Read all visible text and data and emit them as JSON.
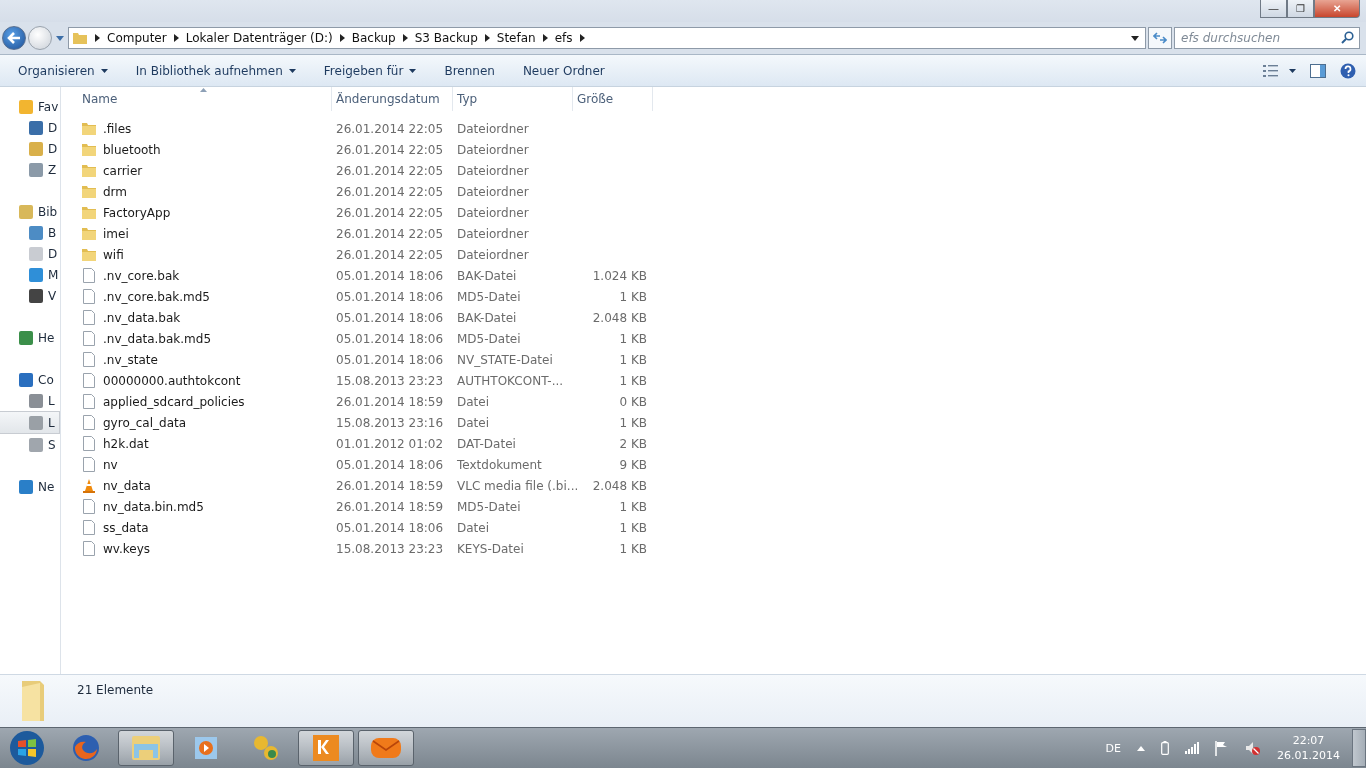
{
  "window": {
    "minimize": "—",
    "maximize": "❐",
    "close": "✕"
  },
  "address": {
    "crumbs": [
      "Computer",
      "Lokaler Datenträger (D:)",
      "Backup",
      "S3 Backup",
      "Stefan",
      "efs"
    ]
  },
  "search": {
    "placeholder": "efs durchsuchen"
  },
  "toolbar": [
    {
      "label": "Organisieren",
      "dropdown": true
    },
    {
      "label": "In Bibliothek aufnehmen",
      "dropdown": true
    },
    {
      "label": "Freigeben für",
      "dropdown": true
    },
    {
      "label": "Brennen",
      "dropdown": false
    },
    {
      "label": "Neuer Ordner",
      "dropdown": false
    }
  ],
  "sidebar": {
    "groups": [
      {
        "label": "Fav",
        "kind": "star",
        "selected": false,
        "children": [
          {
            "label": "D",
            "kind": "desktop",
            "selected": false
          },
          {
            "label": "D",
            "kind": "download",
            "selected": false
          },
          {
            "label": "Z",
            "kind": "recent",
            "selected": false
          }
        ]
      },
      {
        "label": "Bib",
        "kind": "library",
        "selected": false,
        "children": [
          {
            "label": "B",
            "kind": "pictures",
            "selected": false
          },
          {
            "label": "D",
            "kind": "document",
            "selected": false
          },
          {
            "label": "M",
            "kind": "music",
            "selected": false
          },
          {
            "label": "V",
            "kind": "video",
            "selected": false
          }
        ]
      },
      {
        "label": "He",
        "kind": "homegroup",
        "selected": false
      },
      {
        "label": "Co",
        "kind": "computer",
        "selected": false,
        "children": [
          {
            "label": "L",
            "kind": "sysdrive",
            "selected": false
          },
          {
            "label": "L",
            "kind": "drive",
            "selected": true
          },
          {
            "label": "S",
            "kind": "phone",
            "selected": false
          }
        ]
      },
      {
        "label": "Ne",
        "kind": "network",
        "selected": false
      }
    ]
  },
  "table": {
    "columns": [
      "Name",
      "Änderungsdatum",
      "Typ",
      "Größe"
    ],
    "rows": [
      {
        "kind": "folder",
        "name": ".files",
        "date": "26.01.2014 22:05",
        "type": "Dateiordner",
        "size": ""
      },
      {
        "kind": "folder",
        "name": "bluetooth",
        "date": "26.01.2014 22:05",
        "type": "Dateiordner",
        "size": ""
      },
      {
        "kind": "folder",
        "name": "carrier",
        "date": "26.01.2014 22:05",
        "type": "Dateiordner",
        "size": ""
      },
      {
        "kind": "folder",
        "name": "drm",
        "date": "26.01.2014 22:05",
        "type": "Dateiordner",
        "size": ""
      },
      {
        "kind": "folder",
        "name": "FactoryApp",
        "date": "26.01.2014 22:05",
        "type": "Dateiordner",
        "size": ""
      },
      {
        "kind": "folder",
        "name": "imei",
        "date": "26.01.2014 22:05",
        "type": "Dateiordner",
        "size": ""
      },
      {
        "kind": "folder",
        "name": "wifi",
        "date": "26.01.2014 22:05",
        "type": "Dateiordner",
        "size": ""
      },
      {
        "kind": "file",
        "name": ".nv_core.bak",
        "date": "05.01.2014 18:06",
        "type": "BAK-Datei",
        "size": "1.024 KB"
      },
      {
        "kind": "file",
        "name": ".nv_core.bak.md5",
        "date": "05.01.2014 18:06",
        "type": "MD5-Datei",
        "size": "1 KB"
      },
      {
        "kind": "file",
        "name": ".nv_data.bak",
        "date": "05.01.2014 18:06",
        "type": "BAK-Datei",
        "size": "2.048 KB"
      },
      {
        "kind": "file",
        "name": ".nv_data.bak.md5",
        "date": "05.01.2014 18:06",
        "type": "MD5-Datei",
        "size": "1 KB"
      },
      {
        "kind": "file",
        "name": ".nv_state",
        "date": "05.01.2014 18:06",
        "type": "NV_STATE-Datei",
        "size": "1 KB"
      },
      {
        "kind": "file",
        "name": "00000000.authtokcont",
        "date": "15.08.2013 23:23",
        "type": "AUTHTOKCONT-...",
        "size": "1 KB"
      },
      {
        "kind": "file",
        "name": "applied_sdcard_policies",
        "date": "26.01.2014 18:59",
        "type": "Datei",
        "size": "0 KB"
      },
      {
        "kind": "file",
        "name": "gyro_cal_data",
        "date": "15.08.2013 23:16",
        "type": "Datei",
        "size": "1 KB"
      },
      {
        "kind": "file",
        "name": "h2k.dat",
        "date": "01.01.2012 01:02",
        "type": "DAT-Datei",
        "size": "2 KB"
      },
      {
        "kind": "file",
        "name": "nv",
        "date": "05.01.2014 18:06",
        "type": "Textdokument",
        "size": "9 KB"
      },
      {
        "kind": "media",
        "name": "nv_data",
        "date": "26.01.2014 18:59",
        "type": "VLC media file (.bi...",
        "size": "2.048 KB"
      },
      {
        "kind": "file",
        "name": "nv_data.bin.md5",
        "date": "26.01.2014 18:59",
        "type": "MD5-Datei",
        "size": "1 KB"
      },
      {
        "kind": "file",
        "name": "ss_data",
        "date": "05.01.2014 18:06",
        "type": "Datei",
        "size": "1 KB"
      },
      {
        "kind": "file",
        "name": "wv.keys",
        "date": "15.08.2013 23:23",
        "type": "KEYS-Datei",
        "size": "1 KB"
      }
    ]
  },
  "details": {
    "count": "21 Elemente"
  },
  "taskbar": {
    "apps": [
      {
        "kind": "firefox",
        "active": false
      },
      {
        "kind": "explorer",
        "active": true
      },
      {
        "kind": "media",
        "active": false
      },
      {
        "kind": "tools",
        "active": false
      },
      {
        "kind": "kies",
        "active": true
      },
      {
        "kind": "mail",
        "active": true
      }
    ],
    "language": "DE",
    "time": "22:07",
    "date": "26.01.2014"
  }
}
